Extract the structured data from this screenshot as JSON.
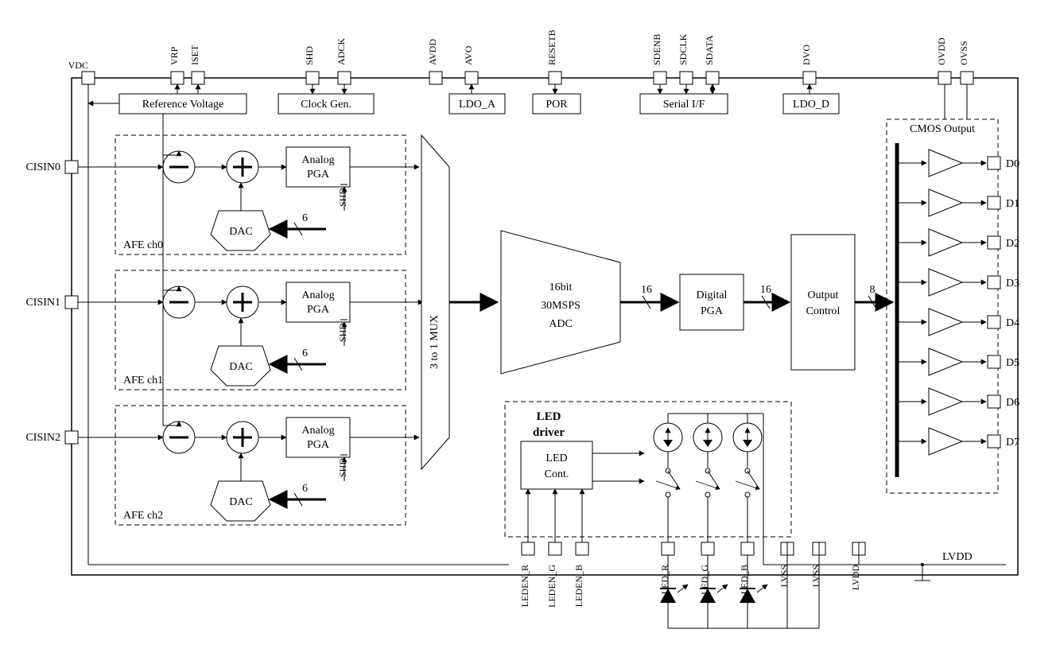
{
  "pins_top": {
    "vdc": "VDC",
    "vrp": "VRP",
    "iset": "ISET",
    "shd": "SHD",
    "adck": "ADCK",
    "avdd": "AVDD",
    "avo": "AVO",
    "resetb": "RESETB",
    "sdenb": "SDENB",
    "sdclk": "SDCLK",
    "sdata": "SDATA",
    "dvo": "DVO",
    "ovdd": "OVDD",
    "ovss": "OVSS"
  },
  "pins_left": {
    "cisin0": "CISIN0",
    "cisin1": "CISIN1",
    "cisin2": "CISIN2"
  },
  "pins_right": {
    "d0": "D0",
    "d1": "D1",
    "d2": "D2",
    "d3": "D3",
    "d4": "D4",
    "d5": "D5",
    "d6": "D6",
    "d7": "D7"
  },
  "pins_bottom": {
    "leden_r": "LEDEN_R",
    "leden_g": "LEDEN_G",
    "leden_b": "LEDEN_B",
    "led_r": "LED_R",
    "led_g": "LED_G",
    "led_b": "LED_B",
    "lvss1": "LVSS",
    "lvss2": "LVSS",
    "lvdd1": "LVDD",
    "lvdd2": "LVDD"
  },
  "blocks": {
    "ref_voltage": "Reference Voltage",
    "clock_gen": "Clock Gen.",
    "ldo_a": "LDO_A",
    "por": "POR",
    "serial_if": "Serial I/F",
    "ldo_d": "LDO_D",
    "cmos_output": "CMOS Output",
    "analog_pga": "Analog\nPGA",
    "dac": "DAC",
    "mux": "3 to 1 MUX",
    "adc_l1": "16bit",
    "adc_l2": "30MSPS",
    "adc_l3": "ADC",
    "digital_pga": "Digital\nPGA",
    "output_control": "Output\nControl",
    "led_driver": "LED\ndriver",
    "led_cont": "LED\nCont.",
    "afe0": "AFE ch0",
    "afe1": "AFE ch1",
    "afe2": "AFE ch2",
    "shd_over": "SHD"
  },
  "bus": {
    "six": "6",
    "sixteen": "16",
    "eight": "8"
  }
}
